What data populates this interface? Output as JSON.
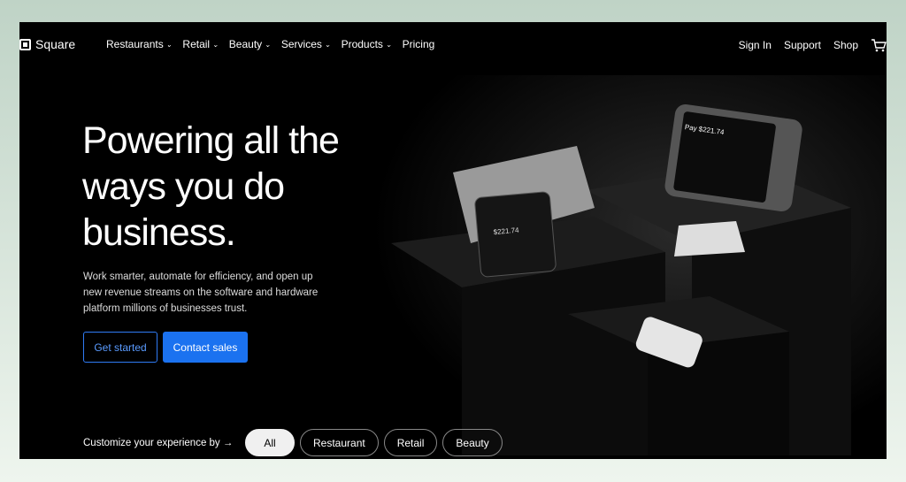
{
  "nav": {
    "brand": "Square",
    "menu": [
      "Restaurants",
      "Retail",
      "Beauty",
      "Services",
      "Products"
    ],
    "pricing": "Pricing",
    "sign_in": "Sign In",
    "support": "Support",
    "shop": "Shop"
  },
  "hero": {
    "title": "Powering all the ways you do business.",
    "subtitle": "Work smarter, automate for efficiency, and open up new revenue streams on the software and hardware platform millions of businesses trust.",
    "get_started": "Get started",
    "contact_sales": "Contact sales"
  },
  "devices": {
    "register_amount": "Pay $221.74",
    "terminal_amount": "$221.74"
  },
  "customize": {
    "label": "Customize your experience by →",
    "options": [
      "All",
      "Restaurant",
      "Retail",
      "Beauty"
    ],
    "selected": "All"
  },
  "colors": {
    "accent": "#1b72f0",
    "background": "#000000"
  }
}
